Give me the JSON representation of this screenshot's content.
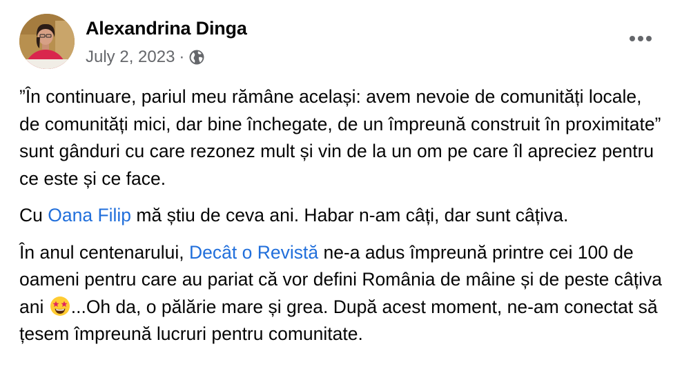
{
  "post": {
    "author": "Alexandrina Dinga",
    "date": "July 2, 2023",
    "separator": "·",
    "audience_icon": "globe-icon",
    "more_icon": "more-options-icon",
    "paragraphs": {
      "p1": "”În continuare, pariul meu rămâne același: avem nevoie de comunități locale, de comunități mici, dar bine închegate, de un împreună construit în proximitate” sunt gânduri cu care rezonez mult și vin de la un om pe care îl apreciez pentru ce este și ce face.",
      "p2_before": "Cu ",
      "p2_link": "Oana Filip",
      "p2_after": " mă știu de ceva ani. Habar n-am câți, dar sunt câțiva.",
      "p3_before": "În anul centenarului, ",
      "p3_link": "Decât o Revistă",
      "p3_middle": " ne-a adus împreună printre cei 100 de oameni pentru care au pariat că vor defini România de mâine și de peste câțiva ani ",
      "p3_emoji": "star-struck-emoji",
      "p3_after": "...Oh da, o pălărie mare și grea. După acest moment, ne-am conectat să țesem împreună lucruri pentru comunitate."
    }
  },
  "colors": {
    "link": "#216fdb",
    "secondary_text": "#65676b",
    "primary_text": "#050505"
  }
}
